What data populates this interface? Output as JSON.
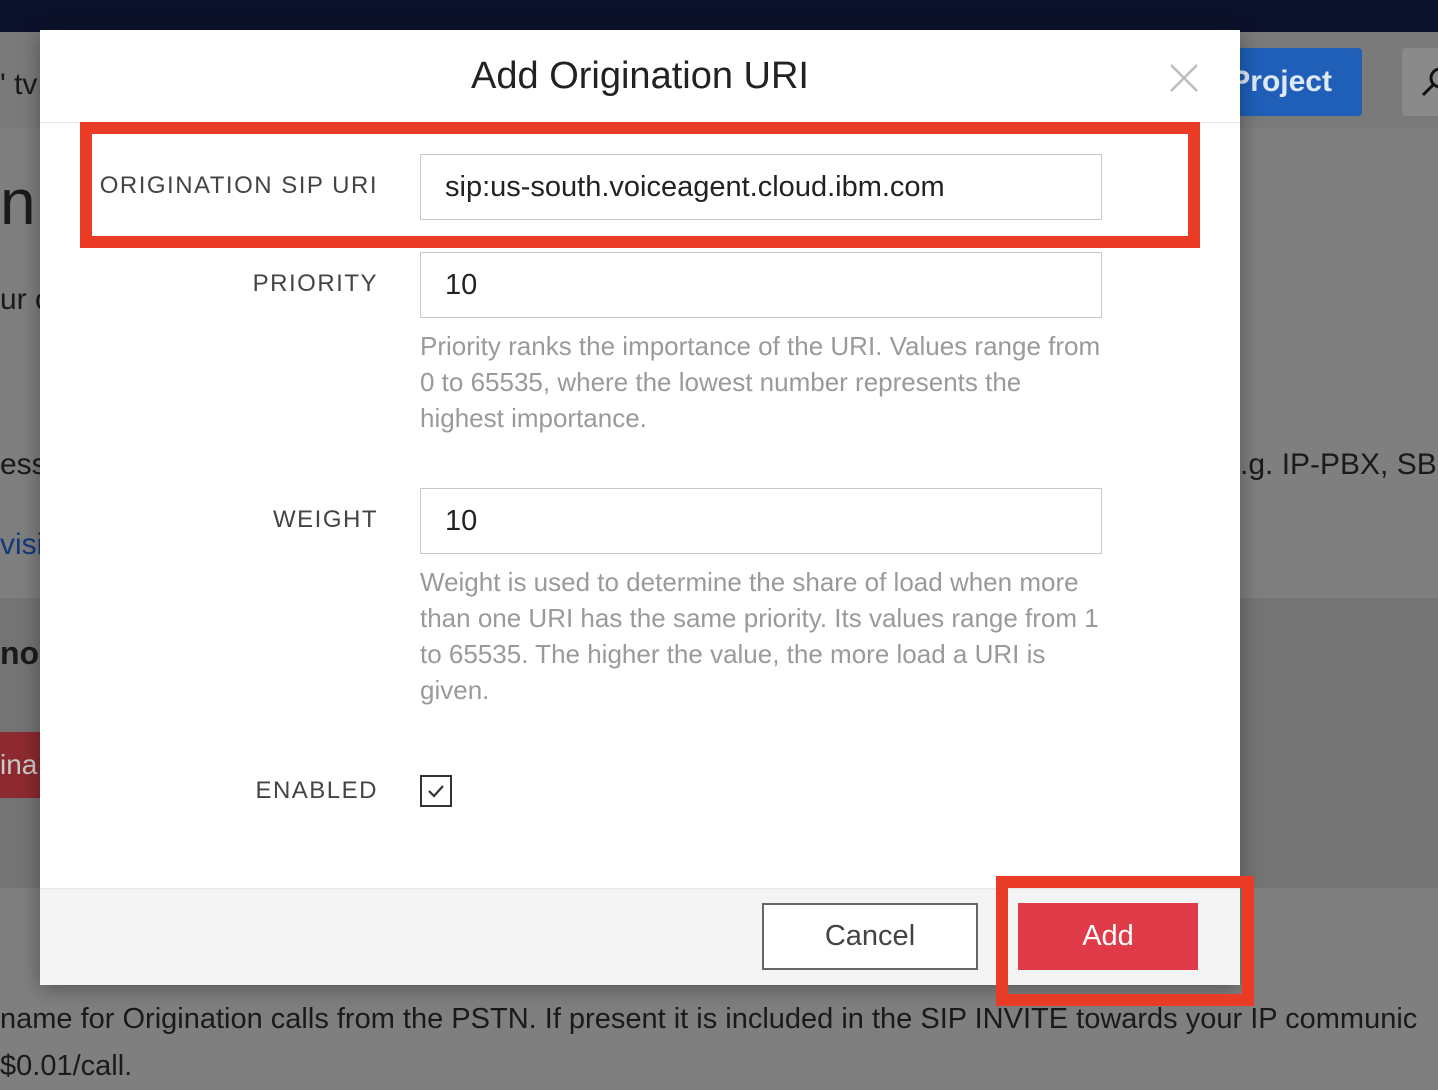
{
  "background": {
    "breadcrumb_fragment": "' tv",
    "project_button": "Project",
    "heading_fragment": "n",
    "line1_fragment": "ur c",
    "line2_fragment": "ess",
    "line2_right_fragment": ".g. IP-PBX, SBC)",
    "link_fragment": "visi",
    "subheading_fragment": "no C",
    "red_button_fragment": "ina",
    "description": "name for Origination calls from the PSTN. If present it is included in the SIP INVITE towards your IP communic",
    "price": "$0.01/call."
  },
  "modal": {
    "title": "Add Origination URI",
    "fields": {
      "sip_uri": {
        "label": "ORIGINATION SIP URI",
        "value": "sip:us-south.voiceagent.cloud.ibm.com"
      },
      "priority": {
        "label": "PRIORITY",
        "value": "10",
        "help": "Priority ranks the importance of the URI. Values range from 0 to 65535, where the lowest number represents the highest importance."
      },
      "weight": {
        "label": "WEIGHT",
        "value": "10",
        "help": "Weight is used to determine the share of load when more than one URI has the same priority. Its values range from 1 to 65535. The higher the value, the more load a URI is given."
      },
      "enabled": {
        "label": "ENABLED",
        "checked": true
      }
    },
    "buttons": {
      "cancel": "Cancel",
      "add": "Add"
    }
  },
  "colors": {
    "highlight": "#ea3b27",
    "add_button": "#e03b48",
    "project_button": "#1f5fb8",
    "topbar": "#0d122b"
  },
  "icons": [
    "close-icon",
    "check-icon",
    "search-icon"
  ]
}
